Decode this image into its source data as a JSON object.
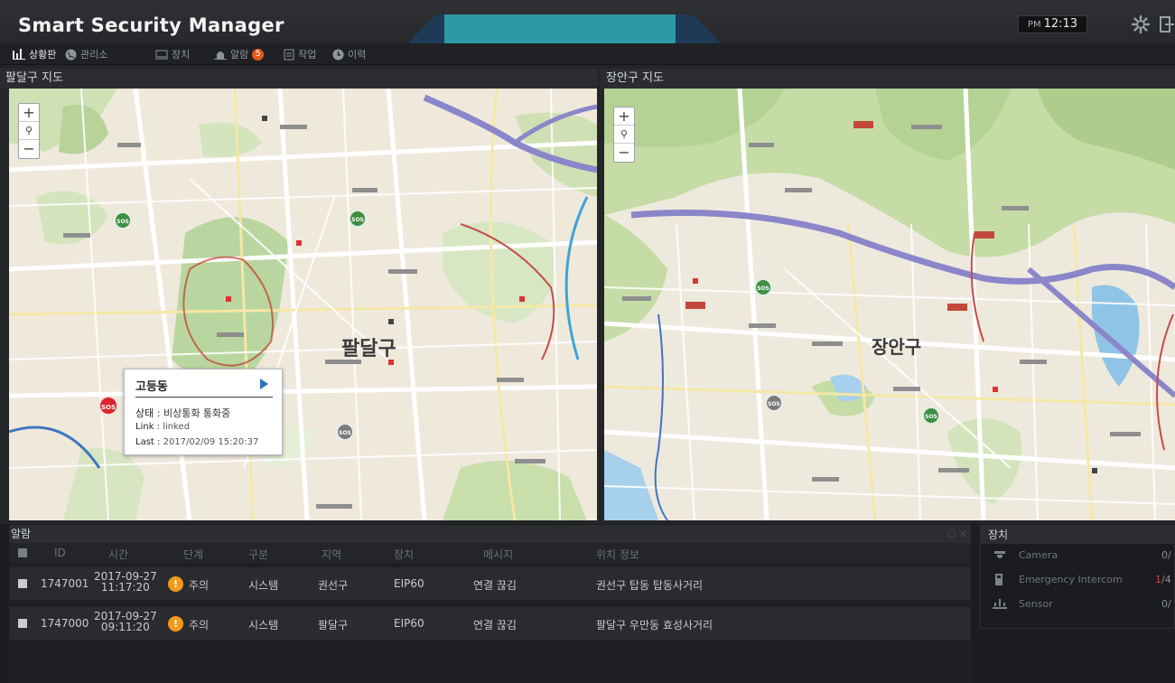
{
  "app": {
    "title": "Smart Security Manager"
  },
  "clock": {
    "ampm": "PM",
    "time": "12:13"
  },
  "nav": {
    "items": [
      {
        "label": "상황판"
      },
      {
        "label": "관리소"
      },
      {
        "label": "장치"
      },
      {
        "label": "알람",
        "badge": "5"
      },
      {
        "label": "작업"
      },
      {
        "label": "이력"
      }
    ]
  },
  "maps": {
    "left": {
      "title": "팔달구 지도",
      "district_label": "팔달구",
      "popup": {
        "title": "고등동",
        "status_key": "상태",
        "status_value": "비상통화 통화중",
        "link_key": "Link",
        "link_value": "linked",
        "last_key": "Last",
        "last_value": "2017/02/09 15:20:37"
      }
    },
    "right": {
      "title": "장안구 지도",
      "district_label": "장안구"
    }
  },
  "alarm": {
    "title": "알람",
    "columns": [
      "ID",
      "시간",
      "단계",
      "구분",
      "지역",
      "장치",
      "메시지",
      "위치 정보"
    ],
    "rows": [
      {
        "id": "1747001",
        "date": "2017-09-27",
        "time": "11:17:20",
        "level": "주의",
        "category": "시스템",
        "region": "권선구",
        "device": "EIP60",
        "message": "연결 끊김",
        "location": "권선구 탑동 탑동사거리"
      },
      {
        "id": "1747000",
        "date": "2017-09-27",
        "time": "09:11:20",
        "level": "주의",
        "category": "시스템",
        "region": "팔달구",
        "device": "EIP60",
        "message": "연결 끊김",
        "location": "팔달구 우만동 효성사거리"
      }
    ]
  },
  "devices": {
    "title": "장치",
    "items": [
      {
        "name": "Camera",
        "count": "0/"
      },
      {
        "name": "Emergency Intercom",
        "count_alert": "1",
        "count_total": "/4"
      },
      {
        "name": "Sensor",
        "count": "0/"
      }
    ]
  },
  "colors": {
    "accent_teal": "#2b9aa4",
    "alert_red": "#d9252b",
    "warn_orange": "#f29a1b",
    "badge": "#e25b1c"
  }
}
